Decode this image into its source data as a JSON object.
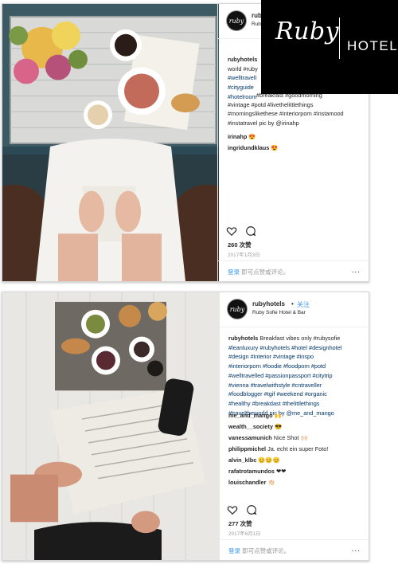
{
  "brand": {
    "name": "Ruby",
    "suffix": "HOTELS"
  },
  "posts": [
    {
      "avatar_text": "ruby",
      "username": "rubyhotels",
      "location": "Ruby",
      "caption_lines": [
        "rubyhotels",
        "world #ruby",
        "#welltravell",
        "#cityguide",
        "#hotelroom"
      ],
      "caption_full_lines": [
        "#breakfast #goodmorning",
        "#vintage #potd #livethelittlethings",
        "#morningslikethese #interiorporn #instamood",
        "#instatravel pic by @irinahp"
      ],
      "comments": [
        {
          "user": "irinahp",
          "text": "😍"
        },
        {
          "user": "ingridundklaus",
          "text": "😍"
        }
      ],
      "likes": "260 次赞",
      "date": "2017年1月3日",
      "login_link": "登录",
      "login_rest": "即可点赞或评论。",
      "more": "..."
    },
    {
      "avatar_text": "ruby",
      "username": "rubyhotels",
      "follow_dot": "•",
      "follow": "关注",
      "location": "Ruby Sofie Hotel & Bar",
      "caption_user": "rubyhotels",
      "caption_first": "Breakfast vibes only #rubysofie",
      "caption_lines": [
        "#leanluxury #rubyhotels #hotel #designhotel",
        "#design #interior #vintage #inspo",
        "#interiorporn #foodie #foodporn #potd",
        "#welltravelled #passionpassport #citytrip",
        "#vienna #travelwithstyle #cntraveller",
        "#foodblogger #tgif #weekend #organic",
        "#healthy #breakdast #thelittlethings",
        "#traveltheworld pic by @me_and_mango"
      ],
      "comments": [
        {
          "user": "me_and_mango",
          "text": "🙌"
        },
        {
          "user": "wealth__society",
          "text": "😎"
        },
        {
          "user": "vanessamunich",
          "text": "Nice Shot 🙌🏻"
        },
        {
          "user": "philippmichel",
          "text": "Ja. echt ein super Foto!"
        },
        {
          "user": "alvin_klbc",
          "text": "😊😊😊"
        },
        {
          "user": "rafatrotamundos",
          "text": "❤❤"
        },
        {
          "user": "louischandler",
          "text": "👏🏻"
        }
      ],
      "likes": "277 次赞",
      "date": "2017年6月1日",
      "login_link": "登录",
      "login_rest": "即可点赞或评论。",
      "more": "..."
    }
  ],
  "icons": [
    "heart-icon",
    "comment-icon"
  ],
  "colors": {
    "link": "#3897f0",
    "hashtag": "#003569",
    "brand_bg": "#000000"
  }
}
